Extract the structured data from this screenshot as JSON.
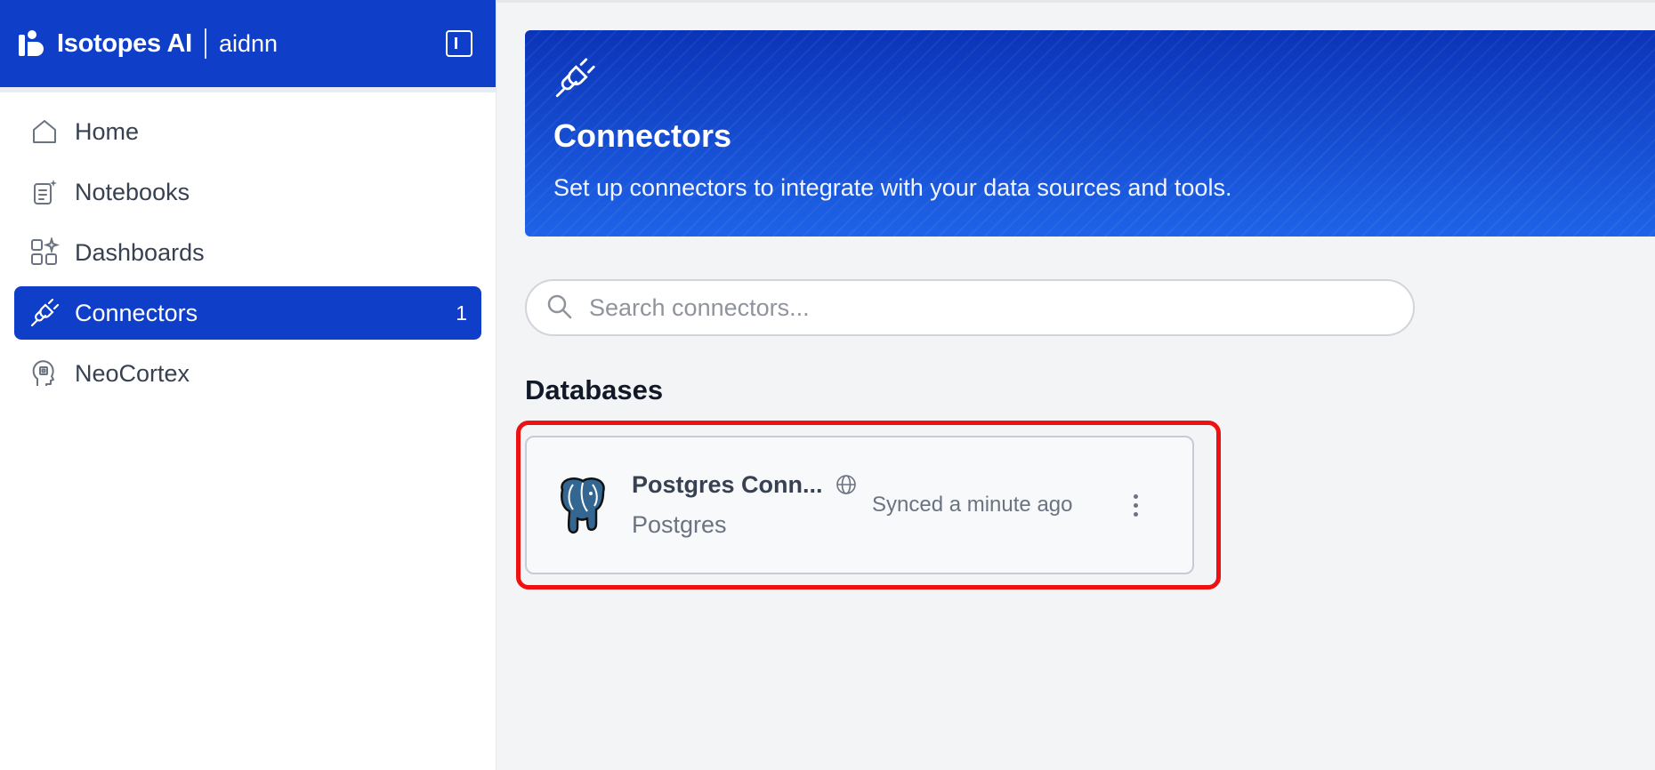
{
  "brand": {
    "name": "Isotopes AI",
    "workspace": "aidnn",
    "color": "#0f3ec9"
  },
  "sidebar": {
    "items": [
      {
        "label": "Home",
        "icon": "home-icon"
      },
      {
        "label": "Notebooks",
        "icon": "notebook-icon"
      },
      {
        "label": "Dashboards",
        "icon": "dashboard-icon"
      },
      {
        "label": "Connectors",
        "icon": "plug-icon",
        "count": "1",
        "active": true
      },
      {
        "label": "NeoCortex",
        "icon": "brain-head-icon"
      }
    ]
  },
  "hero": {
    "icon": "plug-icon",
    "title": "Connectors",
    "subtitle": "Set up connectors to integrate with your data sources and tools."
  },
  "search": {
    "placeholder": "Search connectors..."
  },
  "sections": [
    {
      "title": "Databases",
      "connectors": [
        {
          "name": "Postgres Conn...",
          "type": "Postgres",
          "status": "Synced a minute ago",
          "logo": "postgres-elephant-logo",
          "visibility_icon": "globe-icon"
        }
      ]
    }
  ],
  "highlight_color": "#ee1111"
}
